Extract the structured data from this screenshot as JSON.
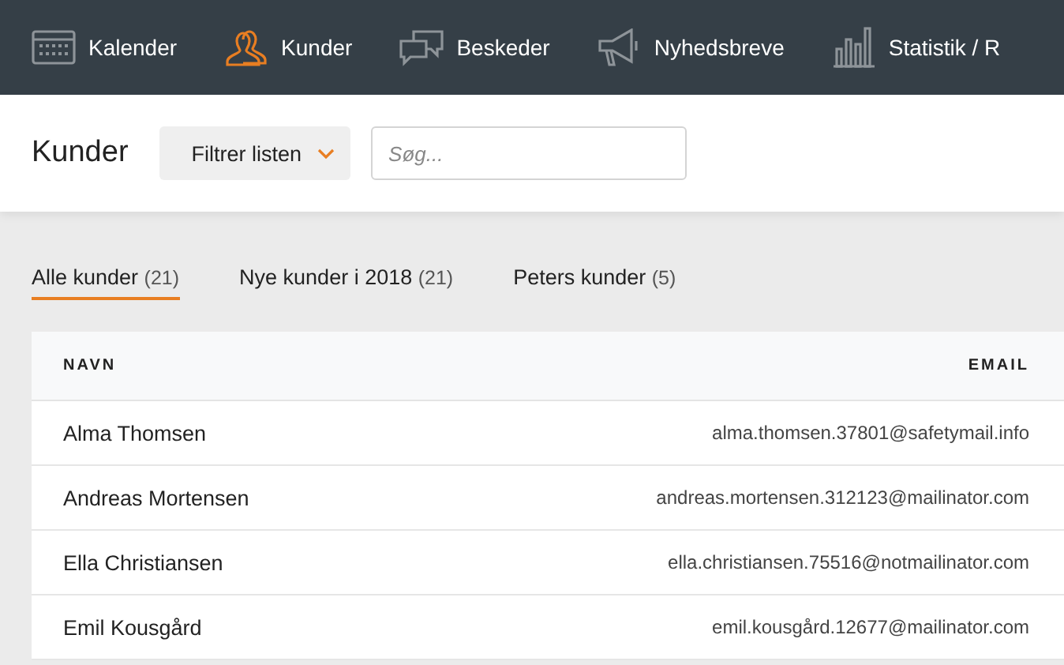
{
  "nav": [
    {
      "label": "Kalender",
      "kind": "calendar",
      "selected": false
    },
    {
      "label": "Kunder",
      "kind": "people",
      "selected": true
    },
    {
      "label": "Beskeder",
      "kind": "chat",
      "selected": false
    },
    {
      "label": "Nyhedsbreve",
      "kind": "megaphone",
      "selected": false
    },
    {
      "label": "Statistik / R",
      "kind": "chart",
      "selected": false
    }
  ],
  "page_title": "Kunder",
  "filter_button": "Filtrer listen",
  "search": {
    "placeholder": "Søg..."
  },
  "tabs": [
    {
      "label": "Alle kunder",
      "count": "(21)",
      "selected": true
    },
    {
      "label": "Nye kunder i 2018",
      "count": "(21)",
      "selected": false
    },
    {
      "label": "Peters kunder",
      "count": "(5)",
      "selected": false
    }
  ],
  "table": {
    "columns": [
      "NAVN",
      "EMAIL"
    ],
    "rows": [
      {
        "name": "Alma Thomsen",
        "email": "alma.thomsen.37801@safetymail.info"
      },
      {
        "name": "Andreas Mortensen",
        "email": "andreas.mortensen.312123@mailinator.com"
      },
      {
        "name": "Ella Christiansen",
        "email": "ella.christiansen.75516@notmailinator.com"
      },
      {
        "name": "Emil Kousgård",
        "email": "emil.kousgård.12677@mailinator.com"
      }
    ]
  }
}
